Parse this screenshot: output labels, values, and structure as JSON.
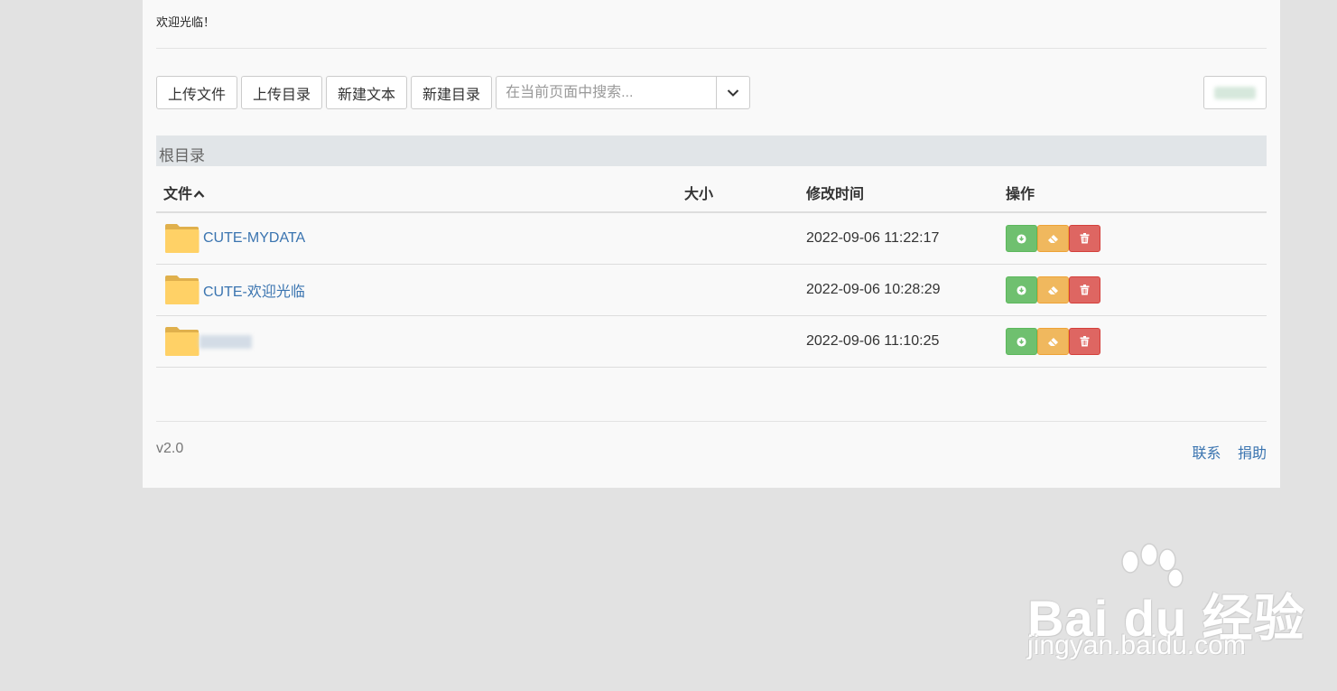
{
  "welcome": "欢迎光临！",
  "toolbar": {
    "upload_file": "上传文件",
    "upload_dir": "上传目录",
    "new_text": "新建文本",
    "new_dir": "新建目录",
    "search_placeholder": "在当前页面中搜索..."
  },
  "breadcrumb": "根目录",
  "table": {
    "headers": {
      "file": "文件",
      "size": "大小",
      "modified": "修改时间",
      "actions": "操作"
    },
    "rows": [
      {
        "name": "CUTE-MYDATA",
        "size": "",
        "modified": "2022-09-06 11:22:17"
      },
      {
        "name": "CUTE-欢迎光临",
        "size": "",
        "modified": "2022-09-06 10:28:29"
      },
      {
        "name": "",
        "size": "",
        "modified": "2022-09-06 11:10:25"
      }
    ]
  },
  "footer": {
    "version": "v2.0",
    "contact": "联系",
    "donate": "捐助"
  },
  "watermark": {
    "brand": "Bai du 经验",
    "url": "jingyan.baidu.com"
  },
  "colors": {
    "link": "#3a74b0",
    "download": "#5cb85c",
    "rename": "#f0ad4e",
    "delete": "#d9534f",
    "folder": "#ffd166"
  }
}
